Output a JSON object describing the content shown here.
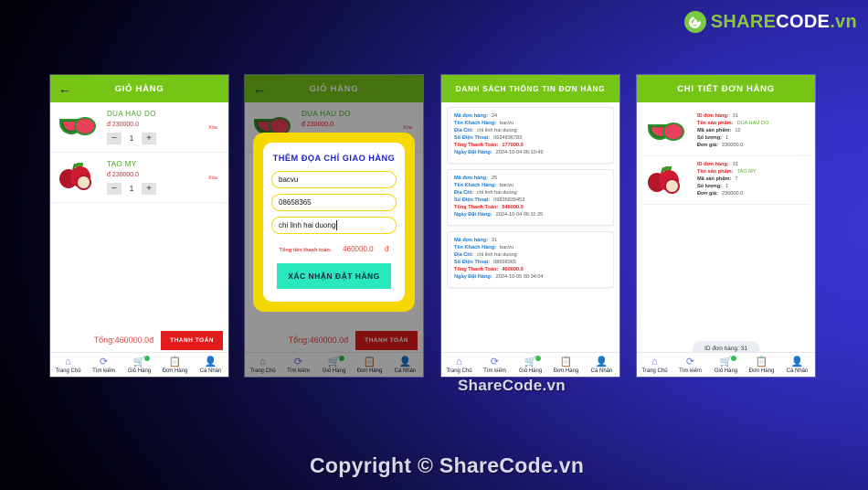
{
  "brand": {
    "logo_share": "SHARE",
    "logo_code": "CODE",
    "logo_vn": ".vn",
    "accent_green": "#8cc63f",
    "watermark_small": "ShareCode.vn",
    "watermark_large": "Copyright © ShareCode.vn"
  },
  "navbar": {
    "items": [
      {
        "icon": "home-icon",
        "glyph": "⌂",
        "label": "Trang Chủ"
      },
      {
        "icon": "search-icon",
        "glyph": "⟳",
        "label": "Tìm kiếm"
      },
      {
        "icon": "cart-icon",
        "glyph": "🛒",
        "label": "Giỏ Hàng"
      },
      {
        "icon": "orders-icon",
        "glyph": "📋",
        "label": "Đơn Hàng"
      },
      {
        "icon": "account-icon",
        "glyph": "👤",
        "label": "Cá Nhân"
      }
    ]
  },
  "phone1": {
    "title": "GIỎ HÀNG",
    "back_icon": "←",
    "items": [
      {
        "name": "DUA HAU DO",
        "price": "đ 230000.0",
        "qty": "1",
        "delete_label": "Xóa",
        "minus": "−",
        "plus": "+",
        "thumb": "watermelon-image"
      },
      {
        "name": "TAO MY",
        "price": "đ 230000.0",
        "qty": "1",
        "delete_label": "Xóa",
        "minus": "−",
        "plus": "+",
        "thumb": "apple-image"
      }
    ],
    "total": "Tổng:460000.0đ",
    "pay_button": "THANH TOÁN"
  },
  "phone2": {
    "title": "GIỎ HÀNG",
    "back_icon": "←",
    "bg_item": {
      "name": "DUA HAU DO",
      "price": "đ 230000.0",
      "delete_label": "Xóa"
    },
    "total": "Tổng:460000.0đ",
    "pay_button": "THANH TOÁN",
    "modal": {
      "title": "THÊM ĐỌA CHỈ GIAO HÀNG",
      "name_value": "bacvu",
      "phone_value": "08658365",
      "address_value": "chi linh hai duong",
      "sum_label": "Tổng tiền thanh toán:",
      "sum_value": "460000.0",
      "sum_currency": "đ",
      "confirm_button": "XÁC NHẬN ĐẶT HÀNG"
    }
  },
  "phone3": {
    "title": "DANH SÁCH THÔNG TIN ĐƠN HÀNG",
    "labels": {
      "code": "Mã đơn hàng:",
      "customer": "Tên Khách Hàng:",
      "address": "Địa Chỉ:",
      "phone": "Số Điện Thoại:",
      "total": "Tổng Thanh Toán:",
      "date": "Ngày Đặt Hàng:"
    },
    "orders": [
      {
        "code": "24",
        "customer": "bacvu",
        "address": "chi linh hai duong",
        "phone": "0624836783",
        "total": "177000.0",
        "date": "2024-10-04 06:10:49"
      },
      {
        "code": "25",
        "customer": "bacvu",
        "address": "chi linh hai duong",
        "phone": "09835839453",
        "total": "546000.0",
        "date": "2024-10-04 06:11:35"
      },
      {
        "code": "31",
        "customer": "bacvu",
        "address": "chi linh hai duong",
        "phone": "08658365",
        "total": "460000.0",
        "date": "2024-10-05 00:34:04"
      }
    ]
  },
  "phone4": {
    "title": "CHI TIẾT ĐƠN HÀNG",
    "labels": {
      "order_id": "ID đơn hàng:",
      "product_name": "Tên sản phẩm:",
      "product_code": "Mã sản phẩm:",
      "quantity": "Số lượng:",
      "unit_price": "Đơn giá:"
    },
    "details": [
      {
        "order_id": "31",
        "product_name": "DUA HAU DO",
        "product_code": "12",
        "quantity": "1",
        "unit_price": "230000.0",
        "thumb": "watermelon-image"
      },
      {
        "order_id": "31",
        "product_name": "TAO MY",
        "product_code": "7",
        "quantity": "1",
        "unit_price": "230000.0",
        "thumb": "apple-image"
      }
    ],
    "toast": "ID đơn hàng: 31"
  }
}
